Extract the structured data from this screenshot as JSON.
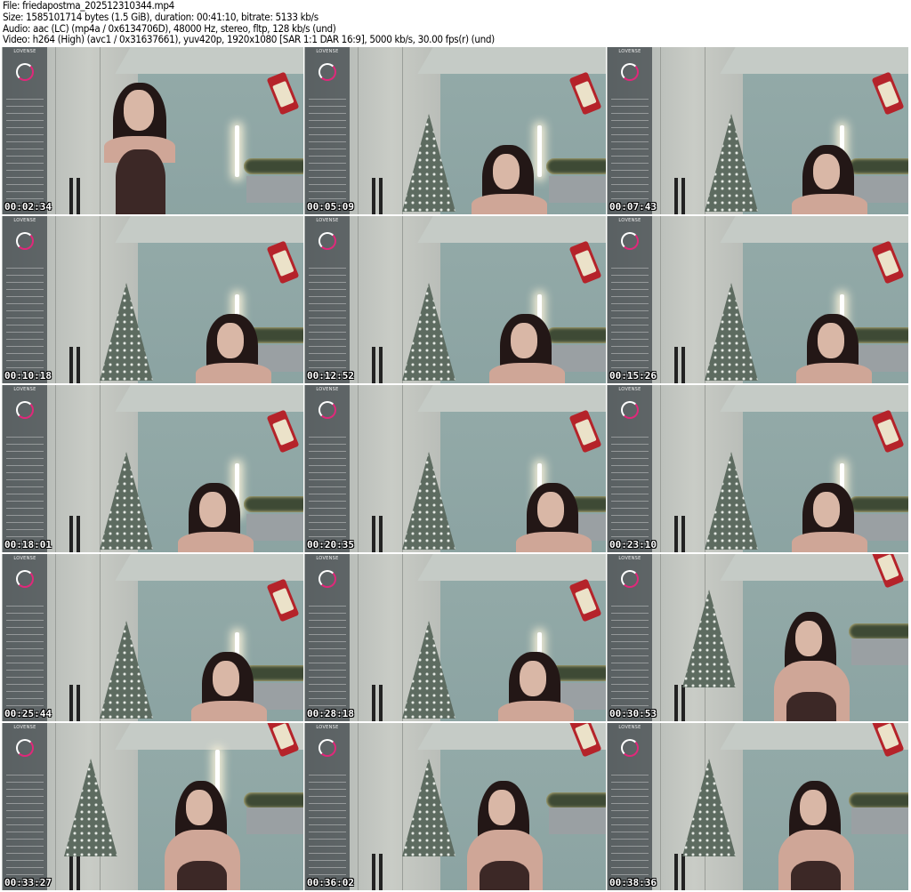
{
  "header": {
    "file": "File: friedapostma_202512310344.mp4",
    "size": "Size: 1585101714 bytes (1.5 GiB), duration: 00:41:10, bitrate: 5133 kb/s",
    "audio": "Audio: aac (LC) (mp4a / 0x6134706D), 48000 Hz, stereo, fltp, 128 kb/s (und)",
    "video": "Video: h264 (High) (avc1 / 0x31637661), yuv420p, 1920x1080 [SAR 1:1 DAR 16:9], 5000 kb/s, 30.00 fps(r) (und)"
  },
  "overlay_logo": "LOVENSE",
  "frames": [
    {
      "timestamp": "00:02:34"
    },
    {
      "timestamp": "00:05:09"
    },
    {
      "timestamp": "00:07:43"
    },
    {
      "timestamp": "00:10:18"
    },
    {
      "timestamp": "00:12:52"
    },
    {
      "timestamp": "00:15:26"
    },
    {
      "timestamp": "00:18:01"
    },
    {
      "timestamp": "00:20:35"
    },
    {
      "timestamp": "00:23:10"
    },
    {
      "timestamp": "00:25:44"
    },
    {
      "timestamp": "00:28:18"
    },
    {
      "timestamp": "00:30:53"
    },
    {
      "timestamp": "00:33:27"
    },
    {
      "timestamp": "00:36:02"
    },
    {
      "timestamp": "00:38:36"
    }
  ]
}
